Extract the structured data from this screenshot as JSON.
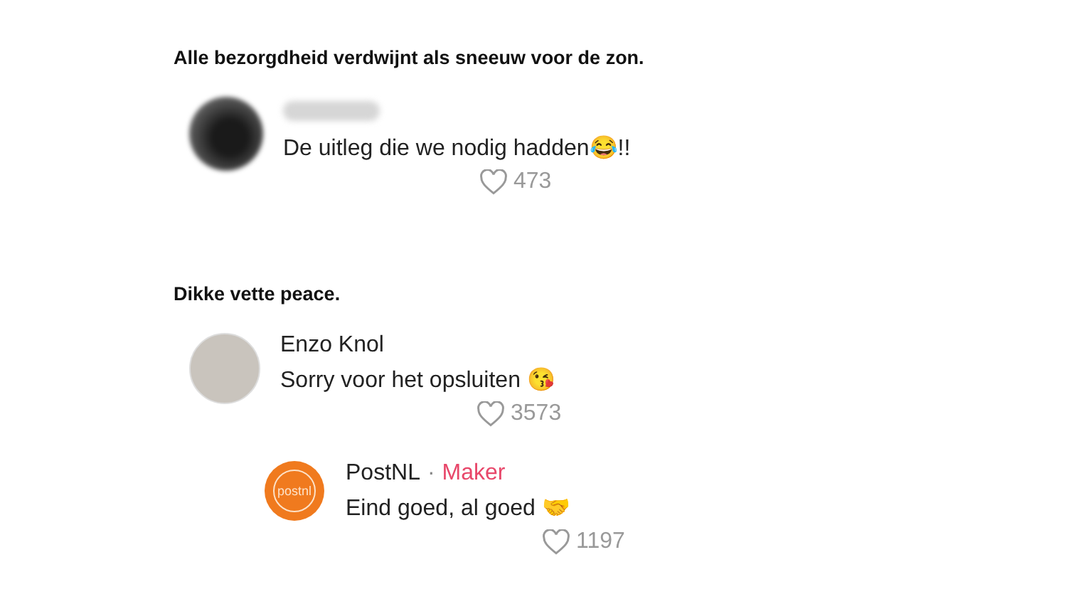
{
  "sections": [
    {
      "caption": "Alle bezorgdheid verdwijnt als sneeuw voor de zon.",
      "comments": [
        {
          "avatar": {
            "kind": "blurred"
          },
          "name_blurred": true,
          "text": "De uitleg die we nodig hadden😂!!",
          "likes": "473"
        }
      ]
    },
    {
      "caption": "Dikke vette peace.",
      "comments": [
        {
          "avatar": {
            "kind": "photo"
          },
          "name": "Enzo Knol",
          "name_blurred": false,
          "text": "Sorry voor het opsluiten 😘",
          "likes": "3573",
          "children": [
            {
              "avatar": {
                "kind": "logo",
                "text": "postnl"
              },
              "name": "PostNL",
              "name_blurred": false,
              "badge_separator": "·",
              "badge": "Maker",
              "text": "Eind goed, al goed 🤝",
              "likes": "1197"
            }
          ]
        }
      ]
    }
  ]
}
